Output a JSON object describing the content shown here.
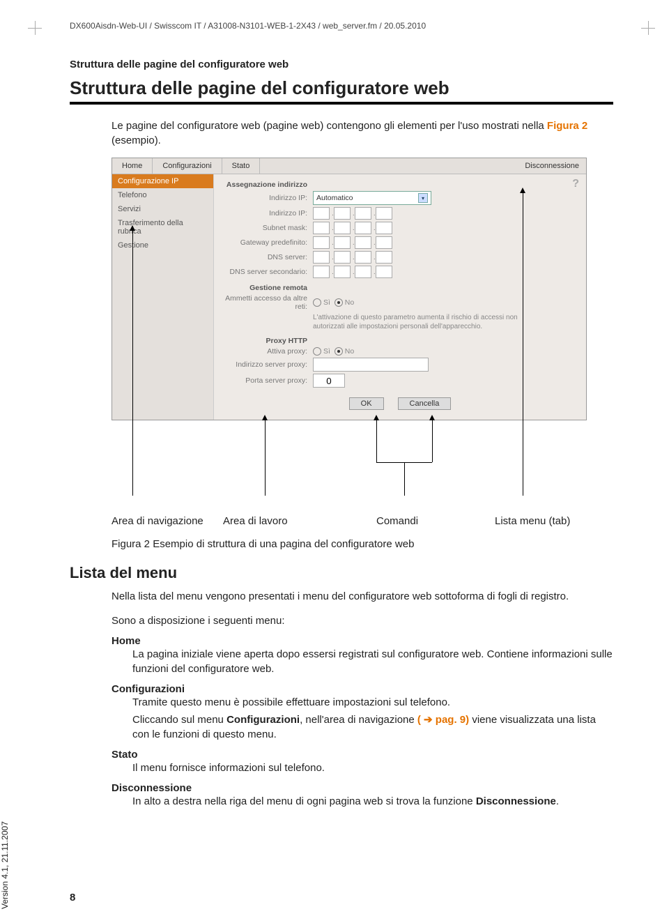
{
  "header_path": "DX600Aisdn-Web-UI / Swisscom IT / A31008-N3101-WEB-1-2X43 / web_server.fm / 20.05.2010",
  "section_label": "Struttura delle pagine del configuratore web",
  "main_title": "Struttura delle pagine del configuratore web",
  "intro": {
    "pre": "Le pagine del configuratore web (pagine web) contengono gli elementi per l'uso mostrati nella ",
    "ref": "Figura 2",
    "post": " (esempio)."
  },
  "screenshot": {
    "tabs": [
      "Home",
      "Configurazioni",
      "Stato"
    ],
    "discon": "Disconnessione",
    "nav": [
      "Configurazione IP",
      "Telefono",
      "Servizi",
      "Trasferimento della rubrica",
      "Gestione"
    ],
    "help": "?",
    "sections": {
      "s1": "Assegnazione indirizzo",
      "ip_label": "Indirizzo IP:",
      "ip_val": "Automatico",
      "ip2_label": "Indirizzo IP:",
      "subnet": "Subnet mask:",
      "gateway": "Gateway predefinito:",
      "dns1": "DNS server:",
      "dns2": "DNS server secondario:",
      "s2": "Gestione remota",
      "allow": "Ammetti accesso da altre reti:",
      "si": "Sì",
      "no": "No",
      "warning": "L'attivazione di questo parametro aumenta il rischio di accessi non autorizzati alle impostazioni personali dell'apparecchio.",
      "s3": "Proxy HTTP",
      "proxy_on": "Attiva proxy:",
      "proxy_addr": "Indirizzo server proxy:",
      "proxy_port": "Porta server proxy:",
      "port_val": "0",
      "ok": "OK",
      "cancel": "Cancella"
    }
  },
  "captions": {
    "nav": "Area di navigazione",
    "work": "Area di lavoro",
    "cmd": "Comandi",
    "tabs": "Lista menu (tab)"
  },
  "figure_caption": "Figura 2 Esempio di struttura di una pagina del configuratore web",
  "lista_heading": "Lista del menu",
  "lista_intro": "Nella lista del menu vengono presentati i menu del configuratore web sottoforma di fogli di registro.",
  "lista_avail": "Sono a disposizione i seguenti menu:",
  "menus": {
    "home": {
      "t": "Home",
      "d1": "La pagina iniziale viene aperta dopo essersi registrati sul configuratore web. Contiene informazioni sulle funzioni del configuratore web."
    },
    "conf": {
      "t": "Configurazioni",
      "d1": "Tramite questo menu è possibile effettuare impostazioni sul telefono.",
      "d2a": "Cliccando sul menu ",
      "d2b": "Configurazioni",
      "d2c": ", nell'area di navigazione ",
      "d2ref": "pag. 9",
      "d2d": " viene visualizzata una lista con le funzioni di questo menu."
    },
    "stato": {
      "t": "Stato",
      "d1": "Il menu fornisce informazioni sul telefono."
    },
    "discon": {
      "t": "Disconnessione",
      "d1a": "In alto a destra nella riga del menu di ogni pagina web si trova la funzione ",
      "d1b": "Disconnessione",
      "d1c": "."
    }
  },
  "page_num": "8",
  "version": "Version 4.1, 21.11.2007"
}
